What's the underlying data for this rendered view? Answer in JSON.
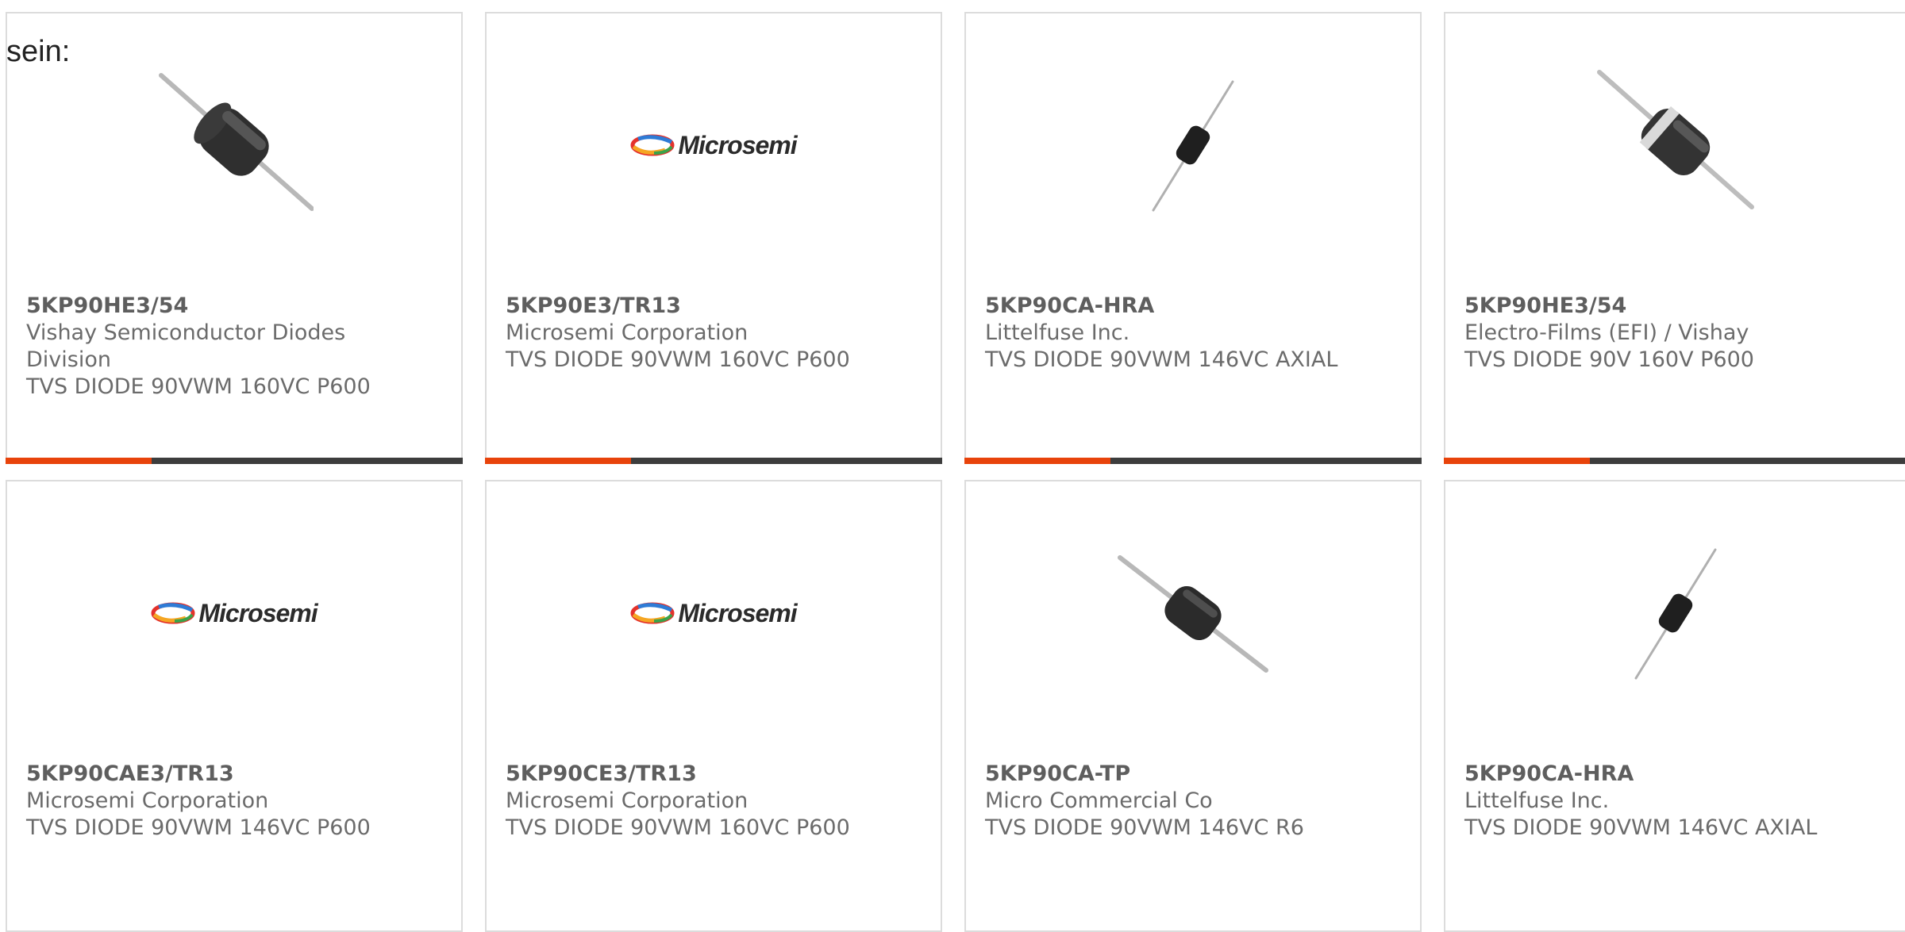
{
  "intro_text": "sein:",
  "colors": {
    "accent": "#e8430b",
    "bar": "#3d3d3d",
    "border": "#dcdcdc"
  },
  "cards": [
    {
      "part": "5KP90HE3/54",
      "manufacturer": "Vishay Semiconductor Diodes Division",
      "description": "TVS DIODE 90VWM 160VC P600",
      "image": "diode-large-icon"
    },
    {
      "part": "5KP90E3/TR13",
      "manufacturer": "Microsemi Corporation",
      "description": "TVS DIODE 90VWM 160VC P600",
      "image": "microsemi-logo"
    },
    {
      "part": "5KP90CA-HRA",
      "manufacturer": "Littelfuse Inc.",
      "description": "TVS DIODE 90VWM 146VC AXIAL",
      "image": "diode-small-icon"
    },
    {
      "part": "5KP90HE3/54",
      "manufacturer": "Electro-Films (EFI) / Vishay",
      "description": "TVS DIODE 90V 160V P600",
      "image": "diode-banded-icon"
    },
    {
      "part": "5KP90CAE3/TR13",
      "manufacturer": "Microsemi Corporation",
      "description": "TVS DIODE 90VWM 146VC P600",
      "image": "microsemi-logo"
    },
    {
      "part": "5KP90CE3/TR13",
      "manufacturer": "Microsemi Corporation",
      "description": "TVS DIODE 90VWM 160VC P600",
      "image": "microsemi-logo"
    },
    {
      "part": "5KP90CA-TP",
      "manufacturer": "Micro Commercial Co",
      "description": "TVS DIODE 90VWM 146VC R6",
      "image": "diode-large-icon"
    },
    {
      "part": "5KP90CA-HRA",
      "manufacturer": "Littelfuse Inc.",
      "description": "TVS DIODE 90VWM 146VC AXIAL",
      "image": "diode-small-icon"
    }
  ],
  "logo_text": "Microsemi"
}
